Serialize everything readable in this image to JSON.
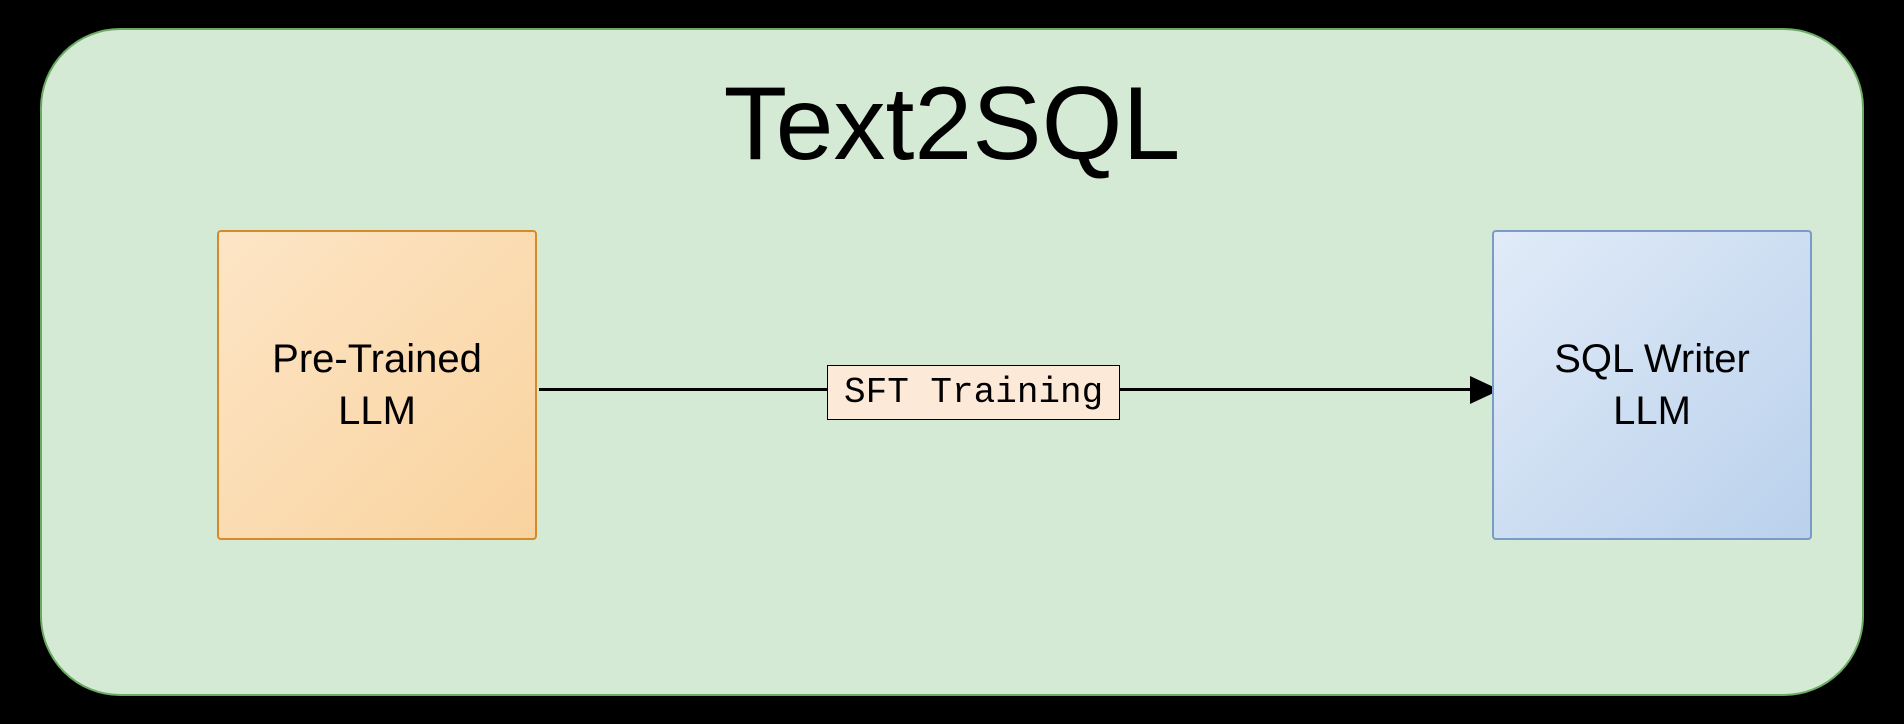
{
  "diagram": {
    "title": "Text2SQL",
    "nodes": {
      "left": {
        "line1": "Pre-Trained",
        "line2": "LLM"
      },
      "right": {
        "line1": "SQL Writer",
        "line2": "LLM"
      }
    },
    "edge": {
      "label": "SFT Training"
    },
    "colors": {
      "container_bg": "#d5ead4",
      "container_border": "#6baa63",
      "left_box_fill": "#fbd9ab",
      "left_box_border": "#d78a2a",
      "right_box_fill": "#cbdcf1",
      "right_box_border": "#7a9bc7",
      "label_fill": "#fce9d8"
    }
  }
}
